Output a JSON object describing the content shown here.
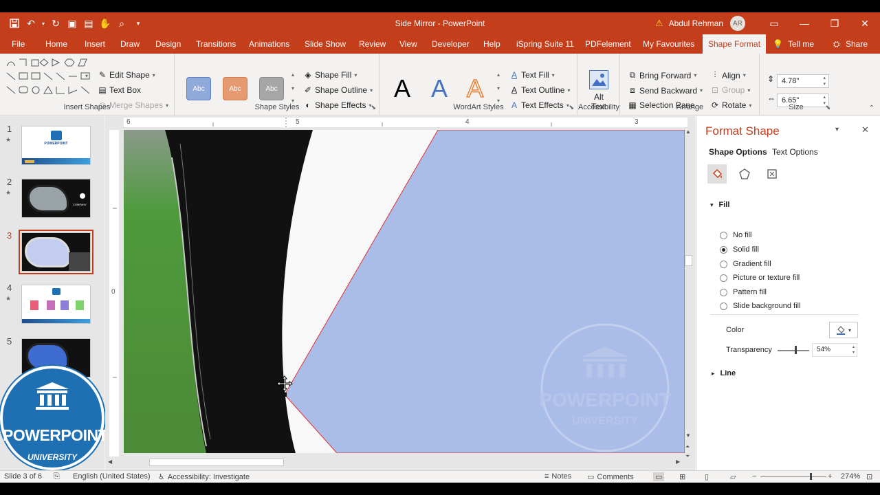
{
  "window": {
    "title": "Side Mirror  -  PowerPoint",
    "user_name": "Abdul Rehman",
    "user_initials": "AR"
  },
  "tabs": [
    "File",
    "Home",
    "Insert",
    "Draw",
    "Design",
    "Transitions",
    "Animations",
    "Slide Show",
    "Review",
    "View",
    "Developer",
    "Help",
    "iSpring Suite 11",
    "PDFelement",
    "My Favourites",
    "Shape Format",
    "Tell me",
    "Share"
  ],
  "ribbon": {
    "insert_shapes": {
      "label": "Insert Shapes",
      "edit_shape": "Edit Shape",
      "text_box": "Text Box",
      "merge_shapes": "Merge Shapes"
    },
    "shape_styles": {
      "label": "Shape Styles",
      "preview": "Abc",
      "colors": [
        "#8fa9d9",
        "#e59a72",
        "#a6a6a6"
      ],
      "shape_fill": "Shape Fill",
      "shape_outline": "Shape Outline",
      "shape_effects": "Shape Effects"
    },
    "wordart": {
      "label": "WordArt Styles",
      "letter": "A",
      "text_fill": "Text Fill",
      "text_outline": "Text Outline",
      "text_effects": "Text Effects"
    },
    "accessibility": {
      "label": "Accessibility",
      "alt_text_1": "Alt",
      "alt_text_2": "Text"
    },
    "arrange": {
      "label": "Arrange",
      "bring_forward": "Bring Forward",
      "send_backward": "Send Backward",
      "selection_pane": "Selection Pane",
      "align": "Align",
      "group": "Group",
      "rotate": "Rotate"
    },
    "size": {
      "label": "Size",
      "height": "4.78\"",
      "width": "6.65\""
    }
  },
  "slides": {
    "numbers": [
      "1",
      "2",
      "3",
      "4",
      "5"
    ],
    "selected_index": 3,
    "thumb2_text": "COMPANY",
    "thumb1_text": "POWERPOINT"
  },
  "ruler": {
    "h_labels": [
      "6",
      "5",
      "4",
      "3"
    ],
    "v_labels": [
      "0"
    ]
  },
  "logo": {
    "line1": "POWERPOINT",
    "line2": "UNIVERSITY"
  },
  "slide_watermark": {
    "line1": "POWERPOINT",
    "line2": "UNIVERSITY"
  },
  "format_pane": {
    "title": "Format Shape",
    "tab_shape": "Shape Options",
    "tab_text": "Text Options",
    "fill_heading": "Fill",
    "options": [
      "No fill",
      "Solid fill",
      "Gradient fill",
      "Picture or texture fill",
      "Pattern fill",
      "Slide background fill"
    ],
    "selected_option": 1,
    "color_label": "Color",
    "transparency_label": "Transparency",
    "transparency_value": "54%",
    "transparency_fraction": 0.54,
    "line_heading": "Line",
    "fill_color": "#3f6cc5"
  },
  "status": {
    "slide": "Slide 3 of 6",
    "language": "English (United States)",
    "accessibility": "Accessibility: Investigate",
    "notes": "Notes",
    "comments": "Comments",
    "zoom": "274%"
  },
  "colors": {
    "accent": "#c43e1c",
    "shape_fill": "#a9bde8"
  }
}
